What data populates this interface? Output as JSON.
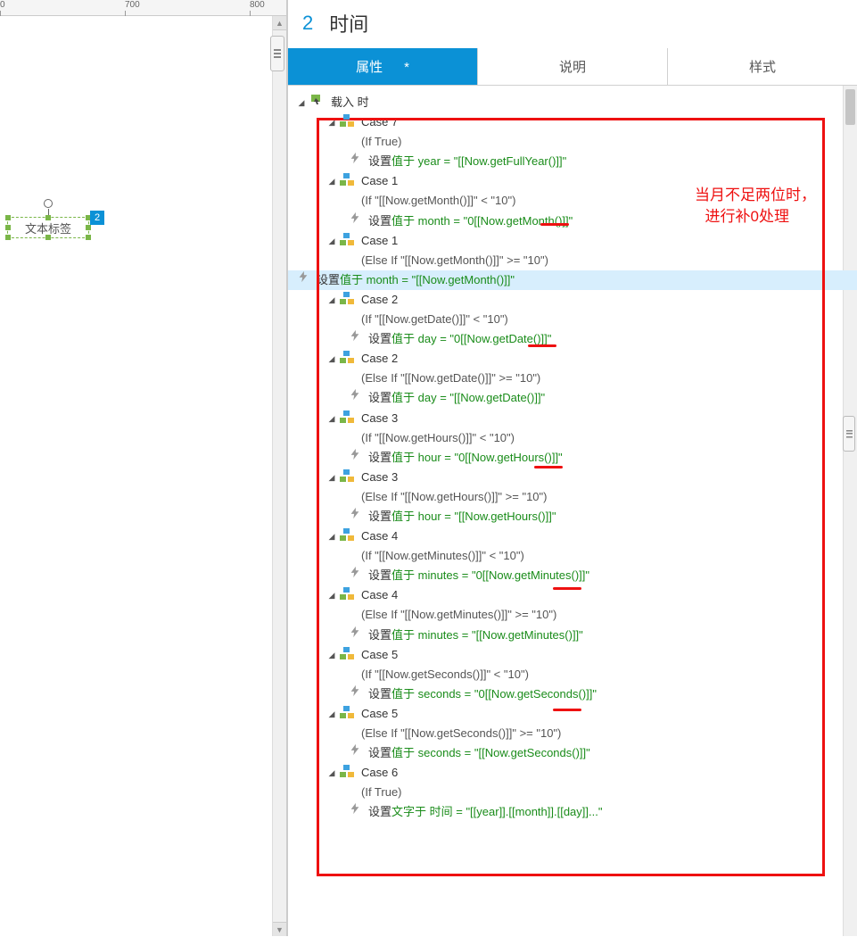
{
  "ruler": {
    "t700": "700",
    "t800": "800"
  },
  "left": {
    "widget_label": "文本标签",
    "badge": "2"
  },
  "header": {
    "index": "2",
    "title": "时间"
  },
  "tabs": {
    "props": "属性",
    "dirty": "*",
    "desc": "说明",
    "style": "样式"
  },
  "event": {
    "load": "载入 时"
  },
  "glyph": {
    "toggle": "◢"
  },
  "common": {
    "set": "设置",
    "valueAt": "值于 "
  },
  "annot": {
    "l1": "当月不足两位时，",
    "l2": "进行补0处理"
  },
  "cases": [
    {
      "name": "Case 7",
      "cond": "(If True)",
      "var": "year",
      "rhs": "\"[[Now.getFullYear()]]\"",
      "underline": false
    },
    {
      "name": "Case 1",
      "cond": "(If \"[[Now.getMonth()]]\" < \"10\")",
      "var": "month",
      "rhs": "\"0[[Now.getMonth()]]\"",
      "underline": true
    },
    {
      "name": "Case 1",
      "cond": "(Else If \"[[Now.getMonth()]]\" >= \"10\")",
      "var": "month",
      "rhs": "\"[[Now.getMonth()]]\"",
      "underline": false,
      "highlight": true
    },
    {
      "name": "Case 2",
      "cond": "(If \"[[Now.getDate()]]\" < \"10\")",
      "var": "day",
      "rhs": "\"0[[Now.getDate()]]\"",
      "underline": true
    },
    {
      "name": "Case 2",
      "cond": "(Else If \"[[Now.getDate()]]\" >= \"10\")",
      "var": "day",
      "rhs": "\"[[Now.getDate()]]\"",
      "underline": false
    },
    {
      "name": "Case 3",
      "cond": "(If \"[[Now.getHours()]]\" < \"10\")",
      "var": "hour",
      "rhs": "\"0[[Now.getHours()]]\"",
      "underline": true
    },
    {
      "name": "Case 3",
      "cond": "(Else If \"[[Now.getHours()]]\" >= \"10\")",
      "var": "hour",
      "rhs": "\"[[Now.getHours()]]\"",
      "underline": false
    },
    {
      "name": "Case 4",
      "cond": "(If \"[[Now.getMinutes()]]\" < \"10\")",
      "var": "minutes",
      "rhs": "\"0[[Now.getMinutes()]]\"",
      "underline": true
    },
    {
      "name": "Case 4",
      "cond": "(Else If \"[[Now.getMinutes()]]\" >= \"10\")",
      "var": "minutes",
      "rhs": "\"[[Now.getMinutes()]]\"",
      "underline": false
    },
    {
      "name": "Case 5",
      "cond": "(If \"[[Now.getSeconds()]]\" < \"10\")",
      "var": "seconds",
      "rhs": "\"0[[Now.getSeconds()]]\"",
      "underline": true
    },
    {
      "name": "Case 5",
      "cond": "(Else If \"[[Now.getSeconds()]]\" >= \"10\")",
      "var": "seconds",
      "rhs": "\"[[Now.getSeconds()]]\"",
      "underline": false
    },
    {
      "name": "Case 6",
      "cond": "(If True)",
      "truncated": true,
      "var": "",
      "rhs": "文字于 时间 = \"[[year]].[[month]].[[day]]...\""
    }
  ]
}
